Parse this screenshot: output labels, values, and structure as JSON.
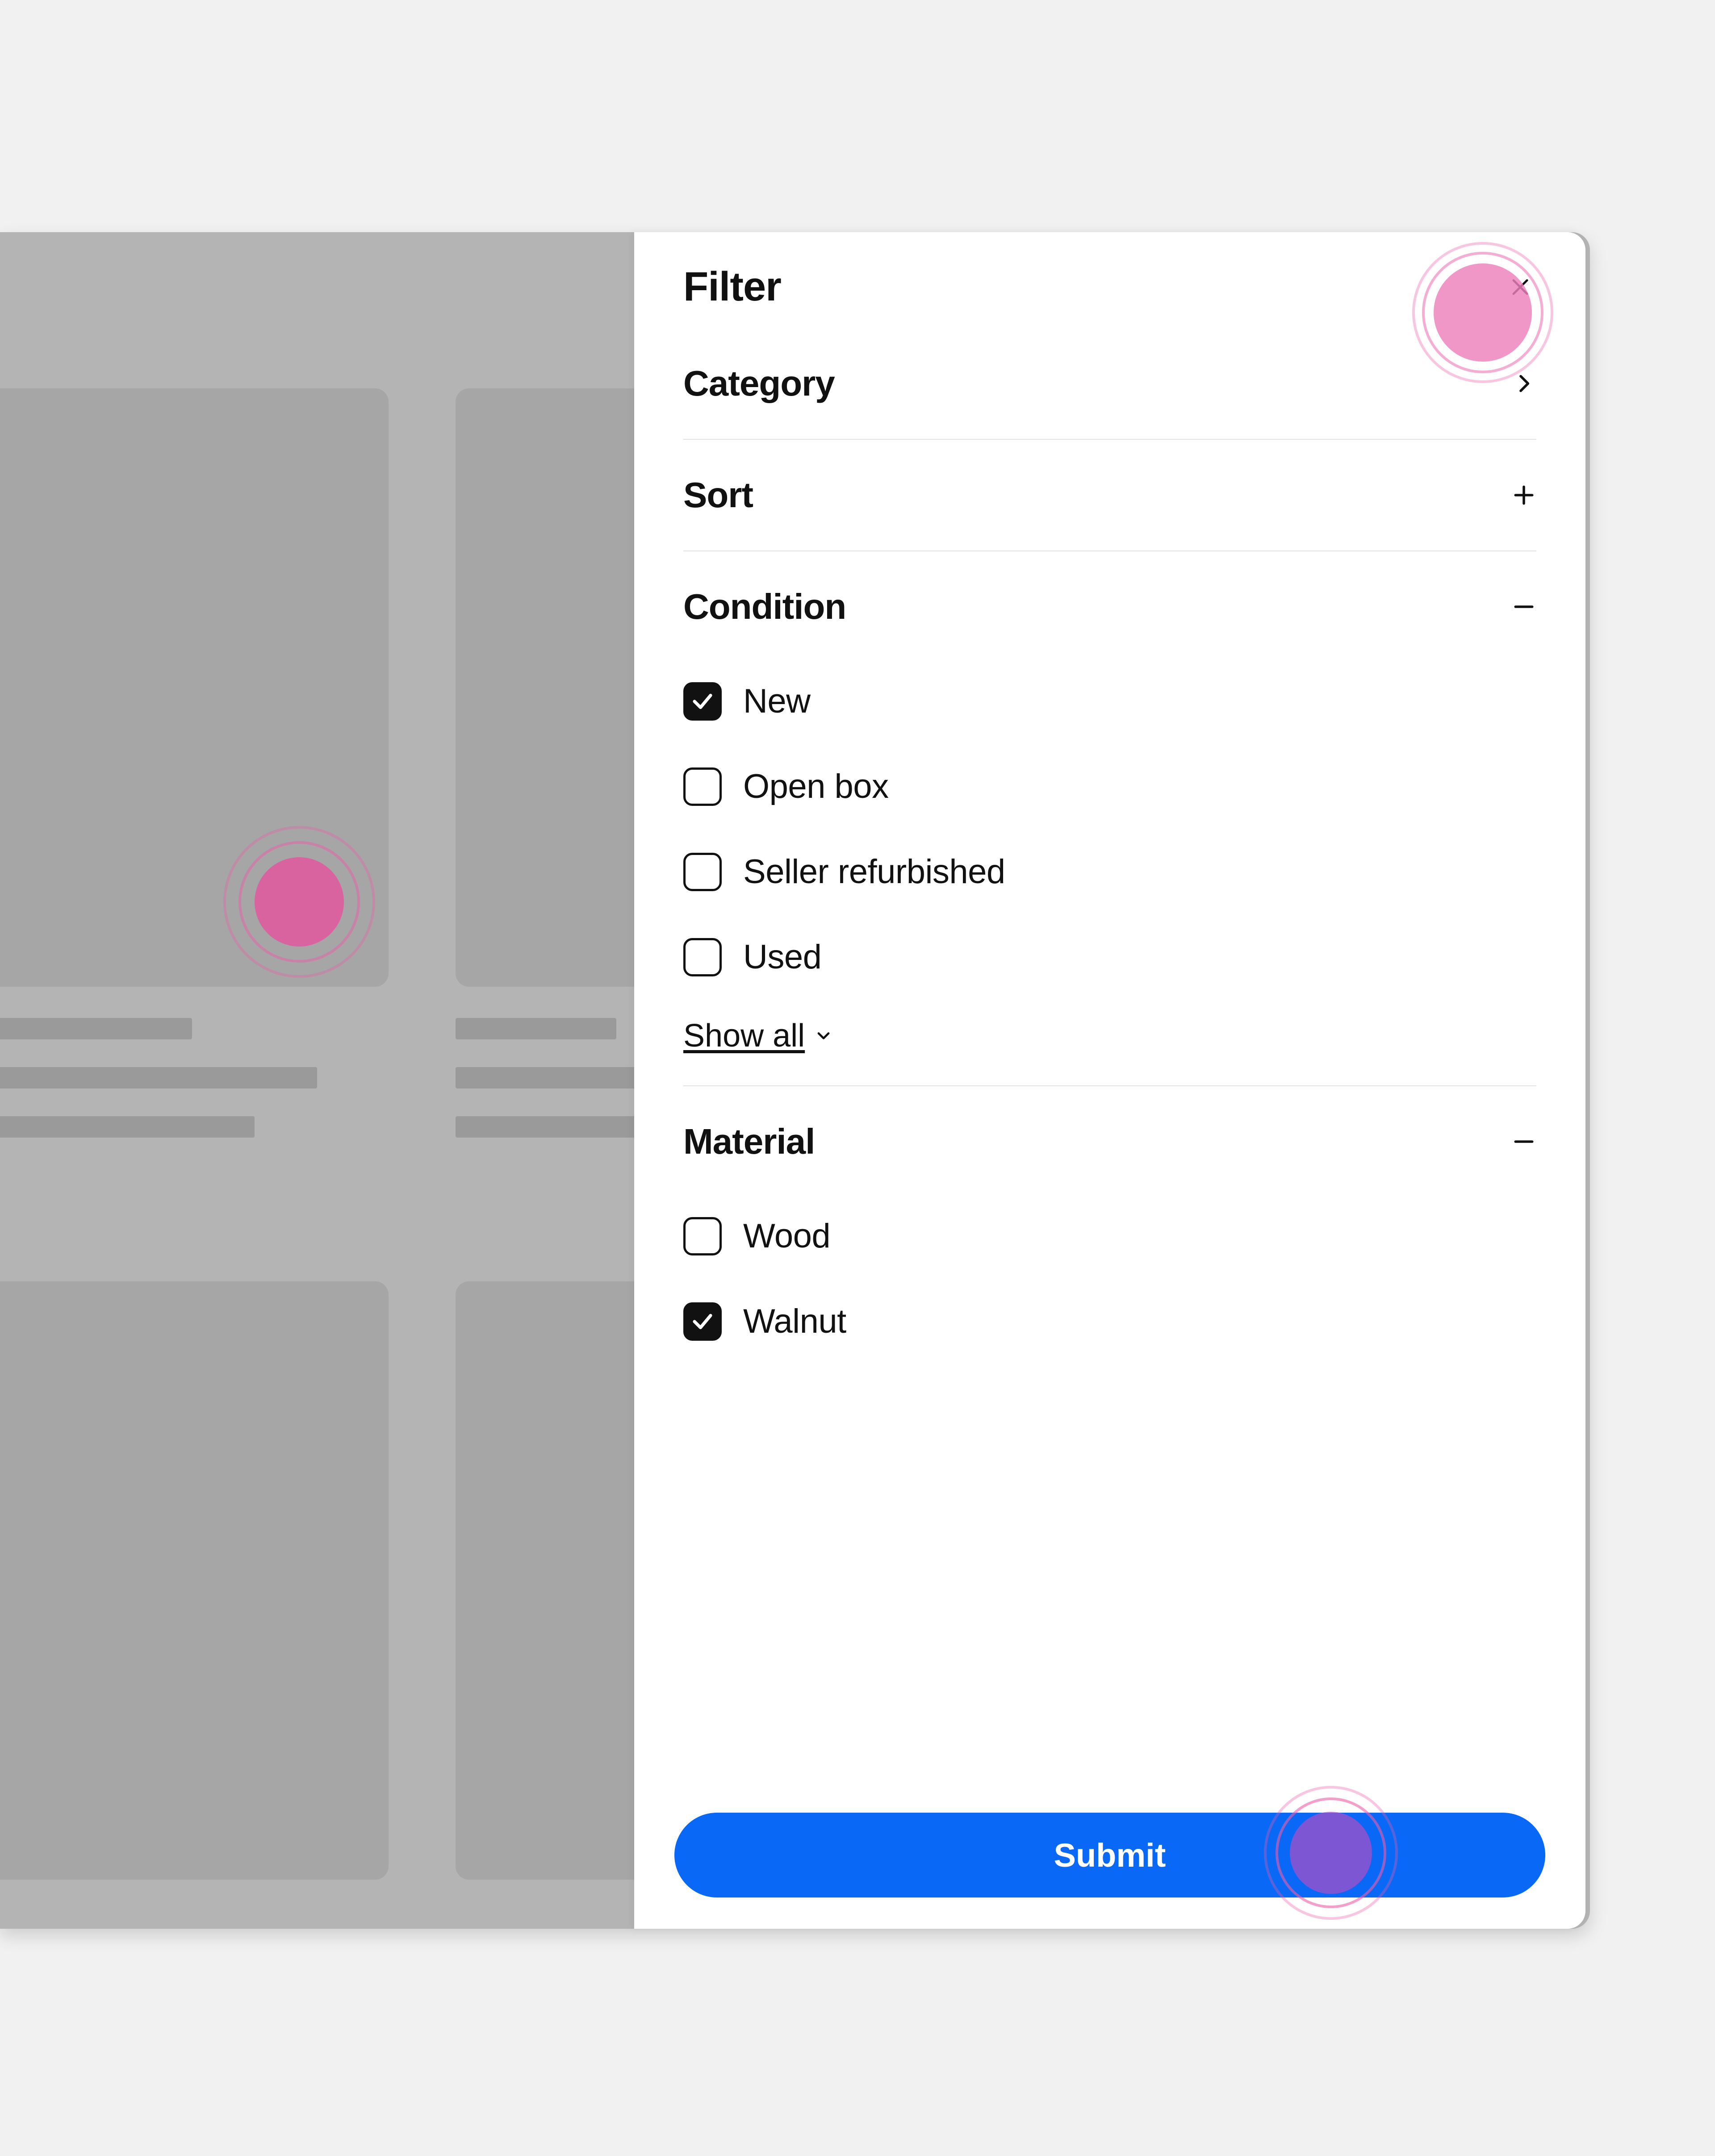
{
  "panel": {
    "title": "Filter",
    "sections": {
      "category": {
        "label": "Category"
      },
      "sort": {
        "label": "Sort"
      },
      "condition": {
        "label": "Condition",
        "options": [
          {
            "label": "New",
            "checked": true
          },
          {
            "label": "Open box",
            "checked": false
          },
          {
            "label": "Seller refurbished",
            "checked": false
          },
          {
            "label": "Used",
            "checked": false
          }
        ],
        "show_all": "Show all"
      },
      "material": {
        "label": "Material",
        "options": [
          {
            "label": "Wood",
            "checked": false
          },
          {
            "label": "Walnut",
            "checked": true
          }
        ]
      }
    },
    "submit": "Submit"
  }
}
